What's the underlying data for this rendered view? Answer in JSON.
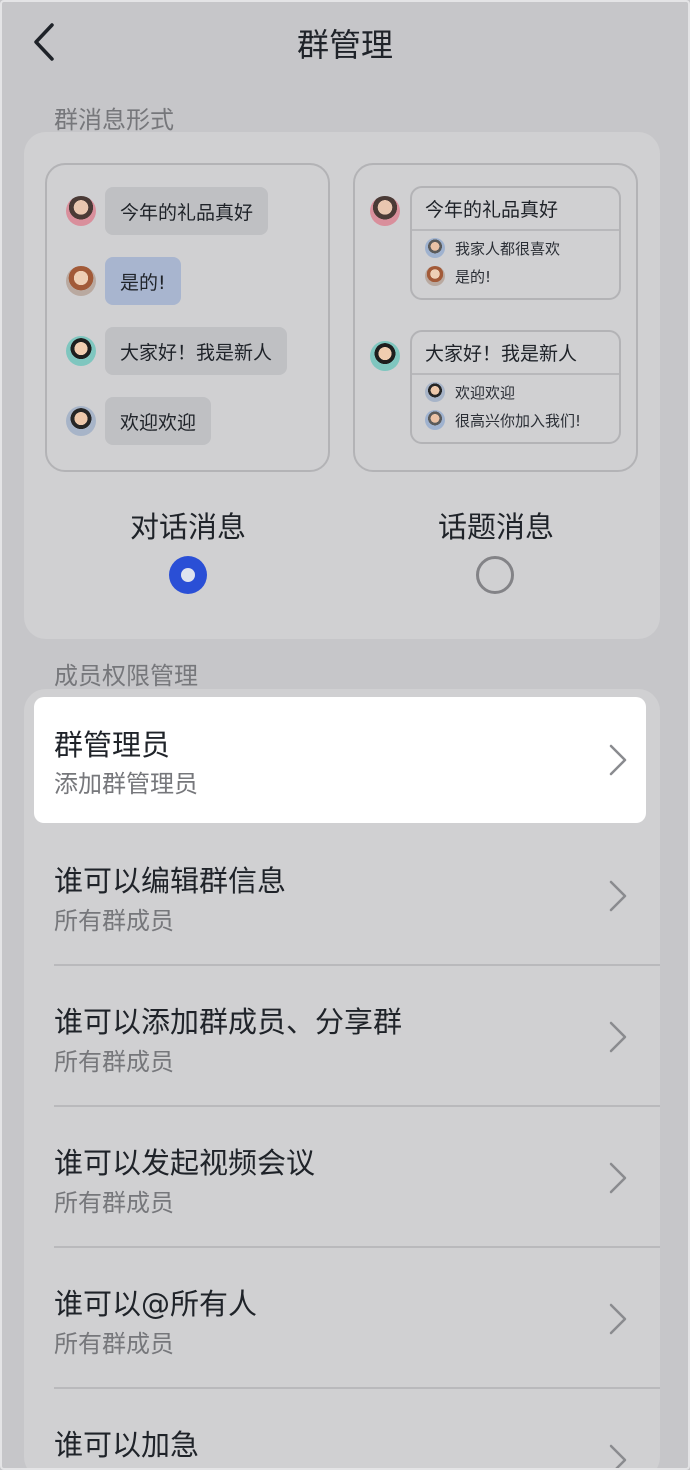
{
  "header": {
    "title": "群管理",
    "back_icon": "chevron-left-icon"
  },
  "message_style": {
    "section_label": "群消息形式",
    "dialog_preview": {
      "messages": [
        {
          "text": "今年的礼品真好"
        },
        {
          "text": "是的!"
        },
        {
          "text": "大家好！我是新人"
        },
        {
          "text": "欢迎欢迎"
        }
      ]
    },
    "topic_preview": {
      "threads": [
        {
          "head": "今年的礼品真好",
          "replies": [
            "我家人都很喜欢",
            "是的!"
          ]
        },
        {
          "head": "大家好！我是新人",
          "replies": [
            "欢迎欢迎",
            "很高兴你加入我们!"
          ]
        }
      ]
    },
    "options": [
      {
        "label": "对话消息",
        "selected": true
      },
      {
        "label": "话题消息",
        "selected": false
      }
    ],
    "accent_color": "#2a4fd6"
  },
  "permissions": {
    "section_label": "成员权限管理",
    "items": [
      {
        "title": "群管理员",
        "subtitle": "添加群管理员"
      },
      {
        "title": "谁可以编辑群信息",
        "subtitle": "所有群成员"
      },
      {
        "title": "谁可以添加群成员、分享群",
        "subtitle": "所有群成员"
      },
      {
        "title": "谁可以发起视频会议",
        "subtitle": "所有群成员"
      },
      {
        "title": "谁可以@所有人",
        "subtitle": "所有群成员"
      },
      {
        "title": "谁可以加急",
        "subtitle": ""
      }
    ]
  }
}
